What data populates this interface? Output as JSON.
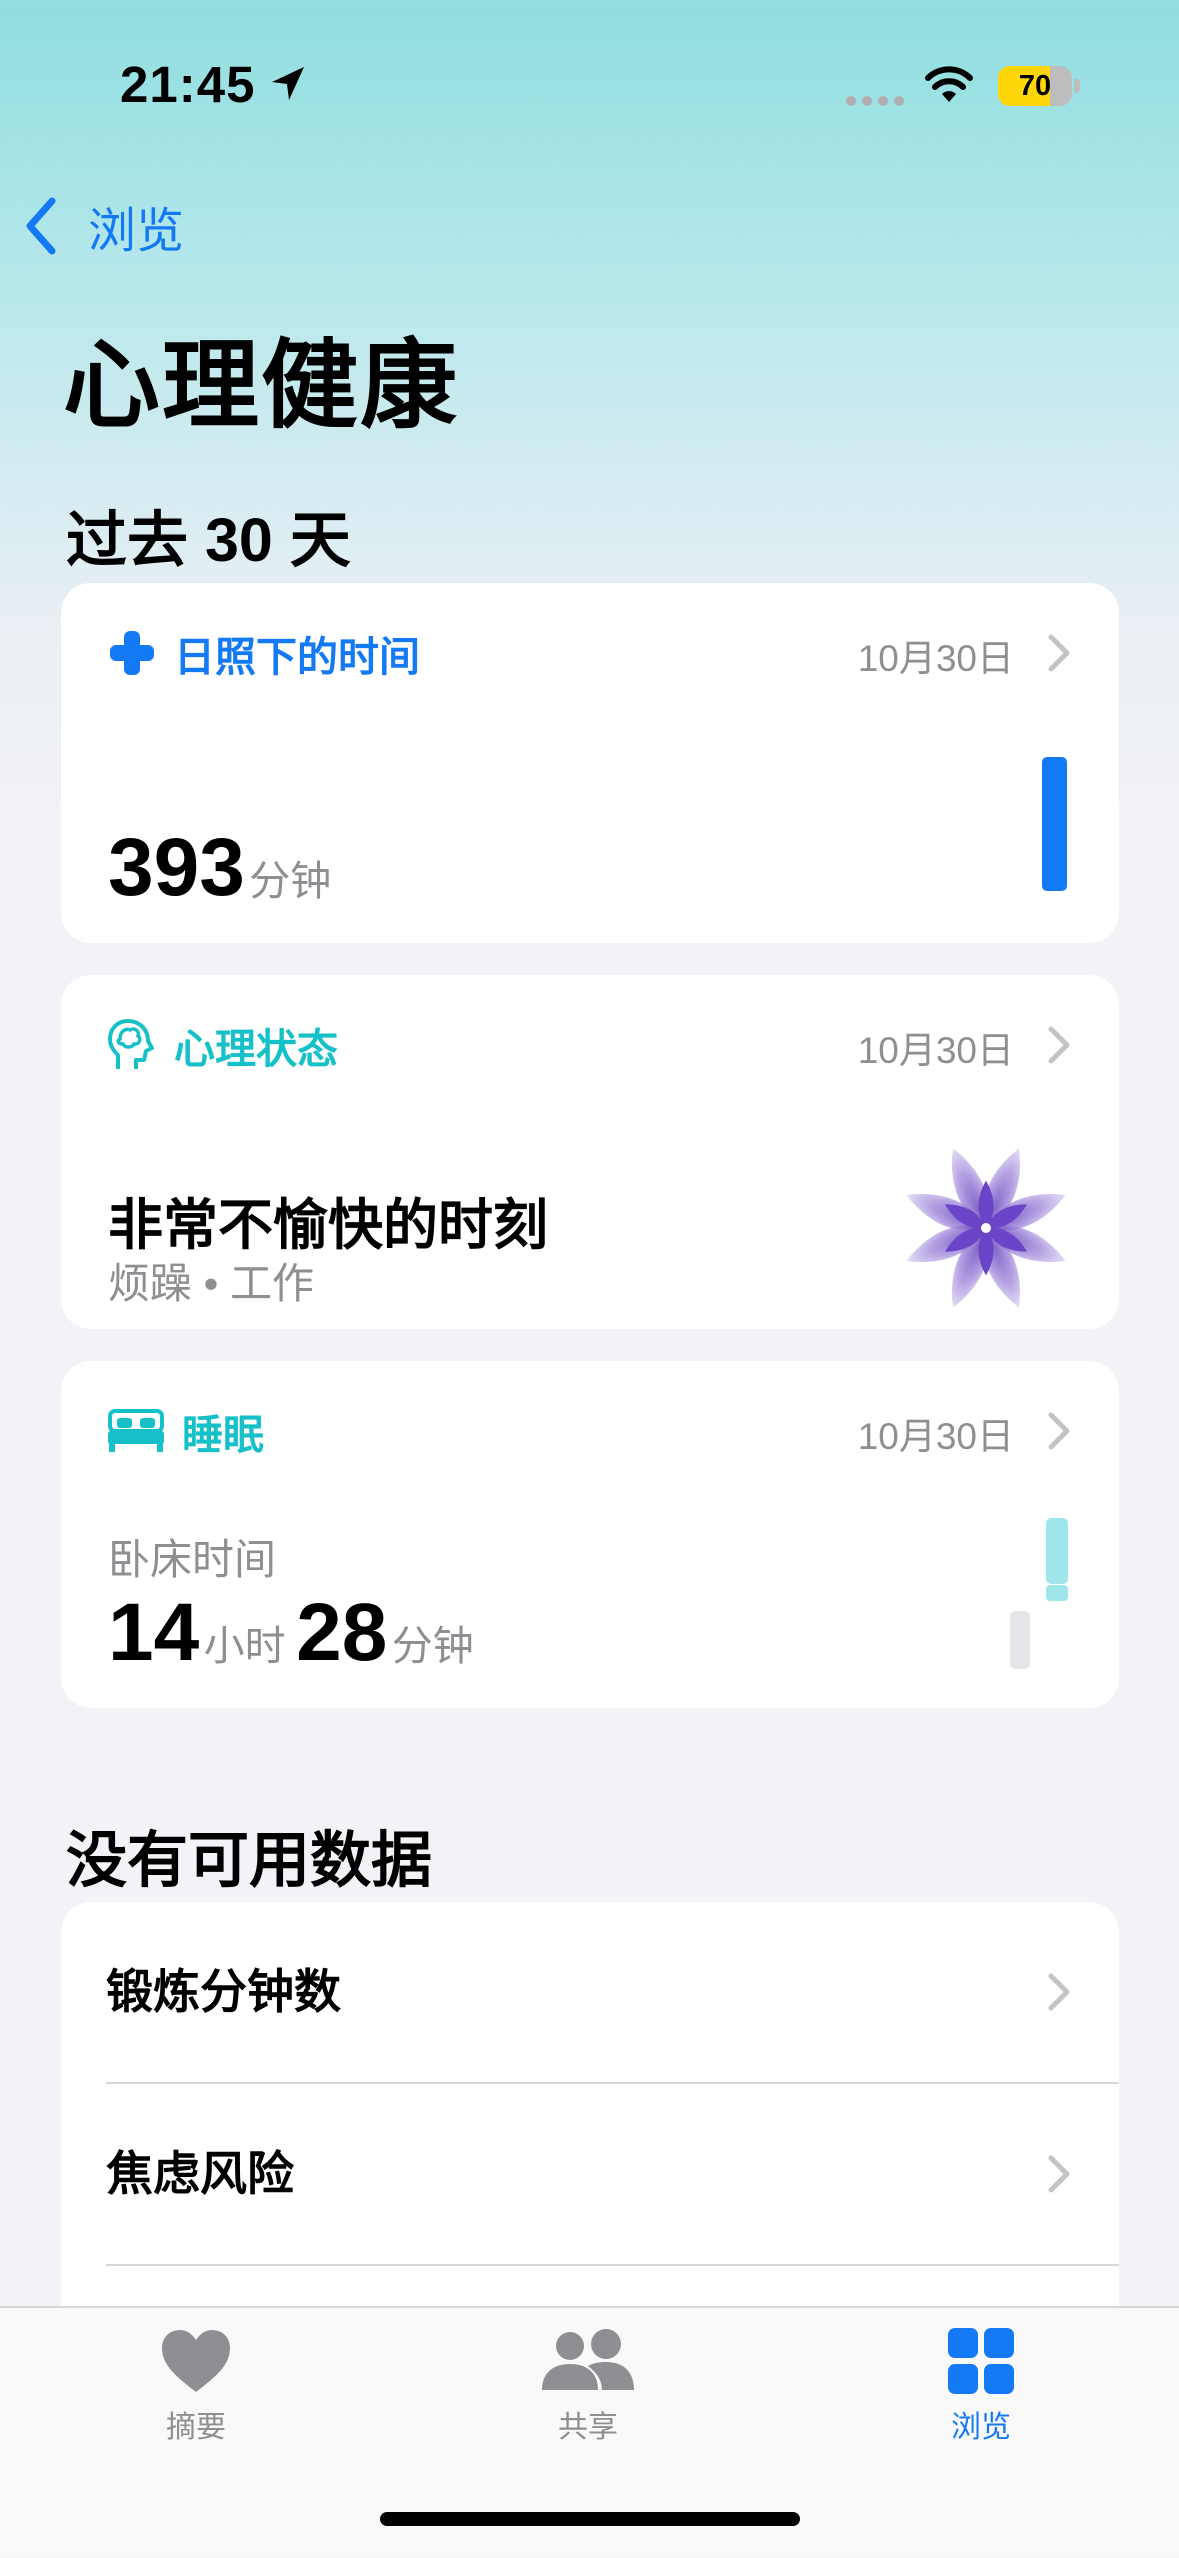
{
  "status_bar": {
    "time": "21:45",
    "battery": "70",
    "battery_level": 0.7
  },
  "nav": {
    "back_label": "浏览",
    "title": "心理健康"
  },
  "section_recent": {
    "heading": "过去 30 天"
  },
  "cards": {
    "daylight": {
      "label": "日照下的时间",
      "date": "10月30日",
      "value": "393",
      "unit": "分钟",
      "accent": "#1479f5"
    },
    "mental": {
      "label": "心理状态",
      "date": "10月30日",
      "title": "非常不愉快的时刻",
      "subtitle": "烦躁 • 工作",
      "accent": "#16c0c8"
    },
    "sleep": {
      "label": "睡眠",
      "date": "10月30日",
      "caption": "卧床时间",
      "hours": "14",
      "hours_unit": "小时",
      "minutes": "28",
      "minutes_unit": "分钟",
      "accent": "#16c0c8"
    }
  },
  "section_nodata": {
    "heading": "没有可用数据",
    "items": [
      {
        "label": "锻炼分钟数"
      },
      {
        "label": "焦虑风险"
      }
    ]
  },
  "tabbar": {
    "tabs": [
      {
        "label": "摘要"
      },
      {
        "label": "共享"
      },
      {
        "label": "浏览"
      }
    ],
    "active_color": "#1479f5"
  }
}
